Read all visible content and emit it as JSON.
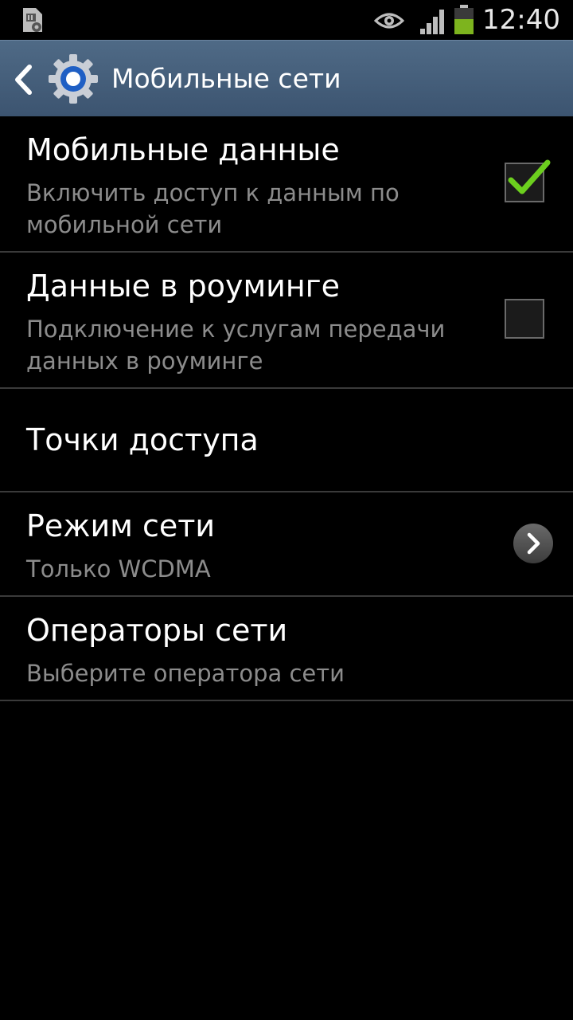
{
  "status_bar": {
    "time": "12:40",
    "icons": [
      "sim-settings-icon",
      "eye-icon",
      "signal-icon",
      "battery-icon"
    ],
    "battery_color": "#7db41e"
  },
  "action_bar": {
    "title": "Мобильные сети",
    "background": "#455f7b",
    "icons": [
      "back-chevron-icon",
      "settings-gear-icon"
    ]
  },
  "settings": {
    "mobile_data": {
      "title": "Мобильные данные",
      "subtitle": "Включить доступ к данным по мобильной сети",
      "checked": true
    },
    "roaming": {
      "title": "Данные в роуминге",
      "subtitle": "Подключение к услугам передачи данных в роуминге",
      "checked": false
    },
    "access_points": {
      "title": "Точки доступа"
    },
    "network_mode": {
      "title": "Режим сети",
      "subtitle": "Только WCDMA"
    },
    "network_operators": {
      "title": "Операторы сети",
      "subtitle": "Выберите оператора сети"
    }
  },
  "colors": {
    "check_green": "#6ccf1e",
    "subtitle_gray": "#8c8c8c",
    "divider": "#3a3a3a"
  }
}
